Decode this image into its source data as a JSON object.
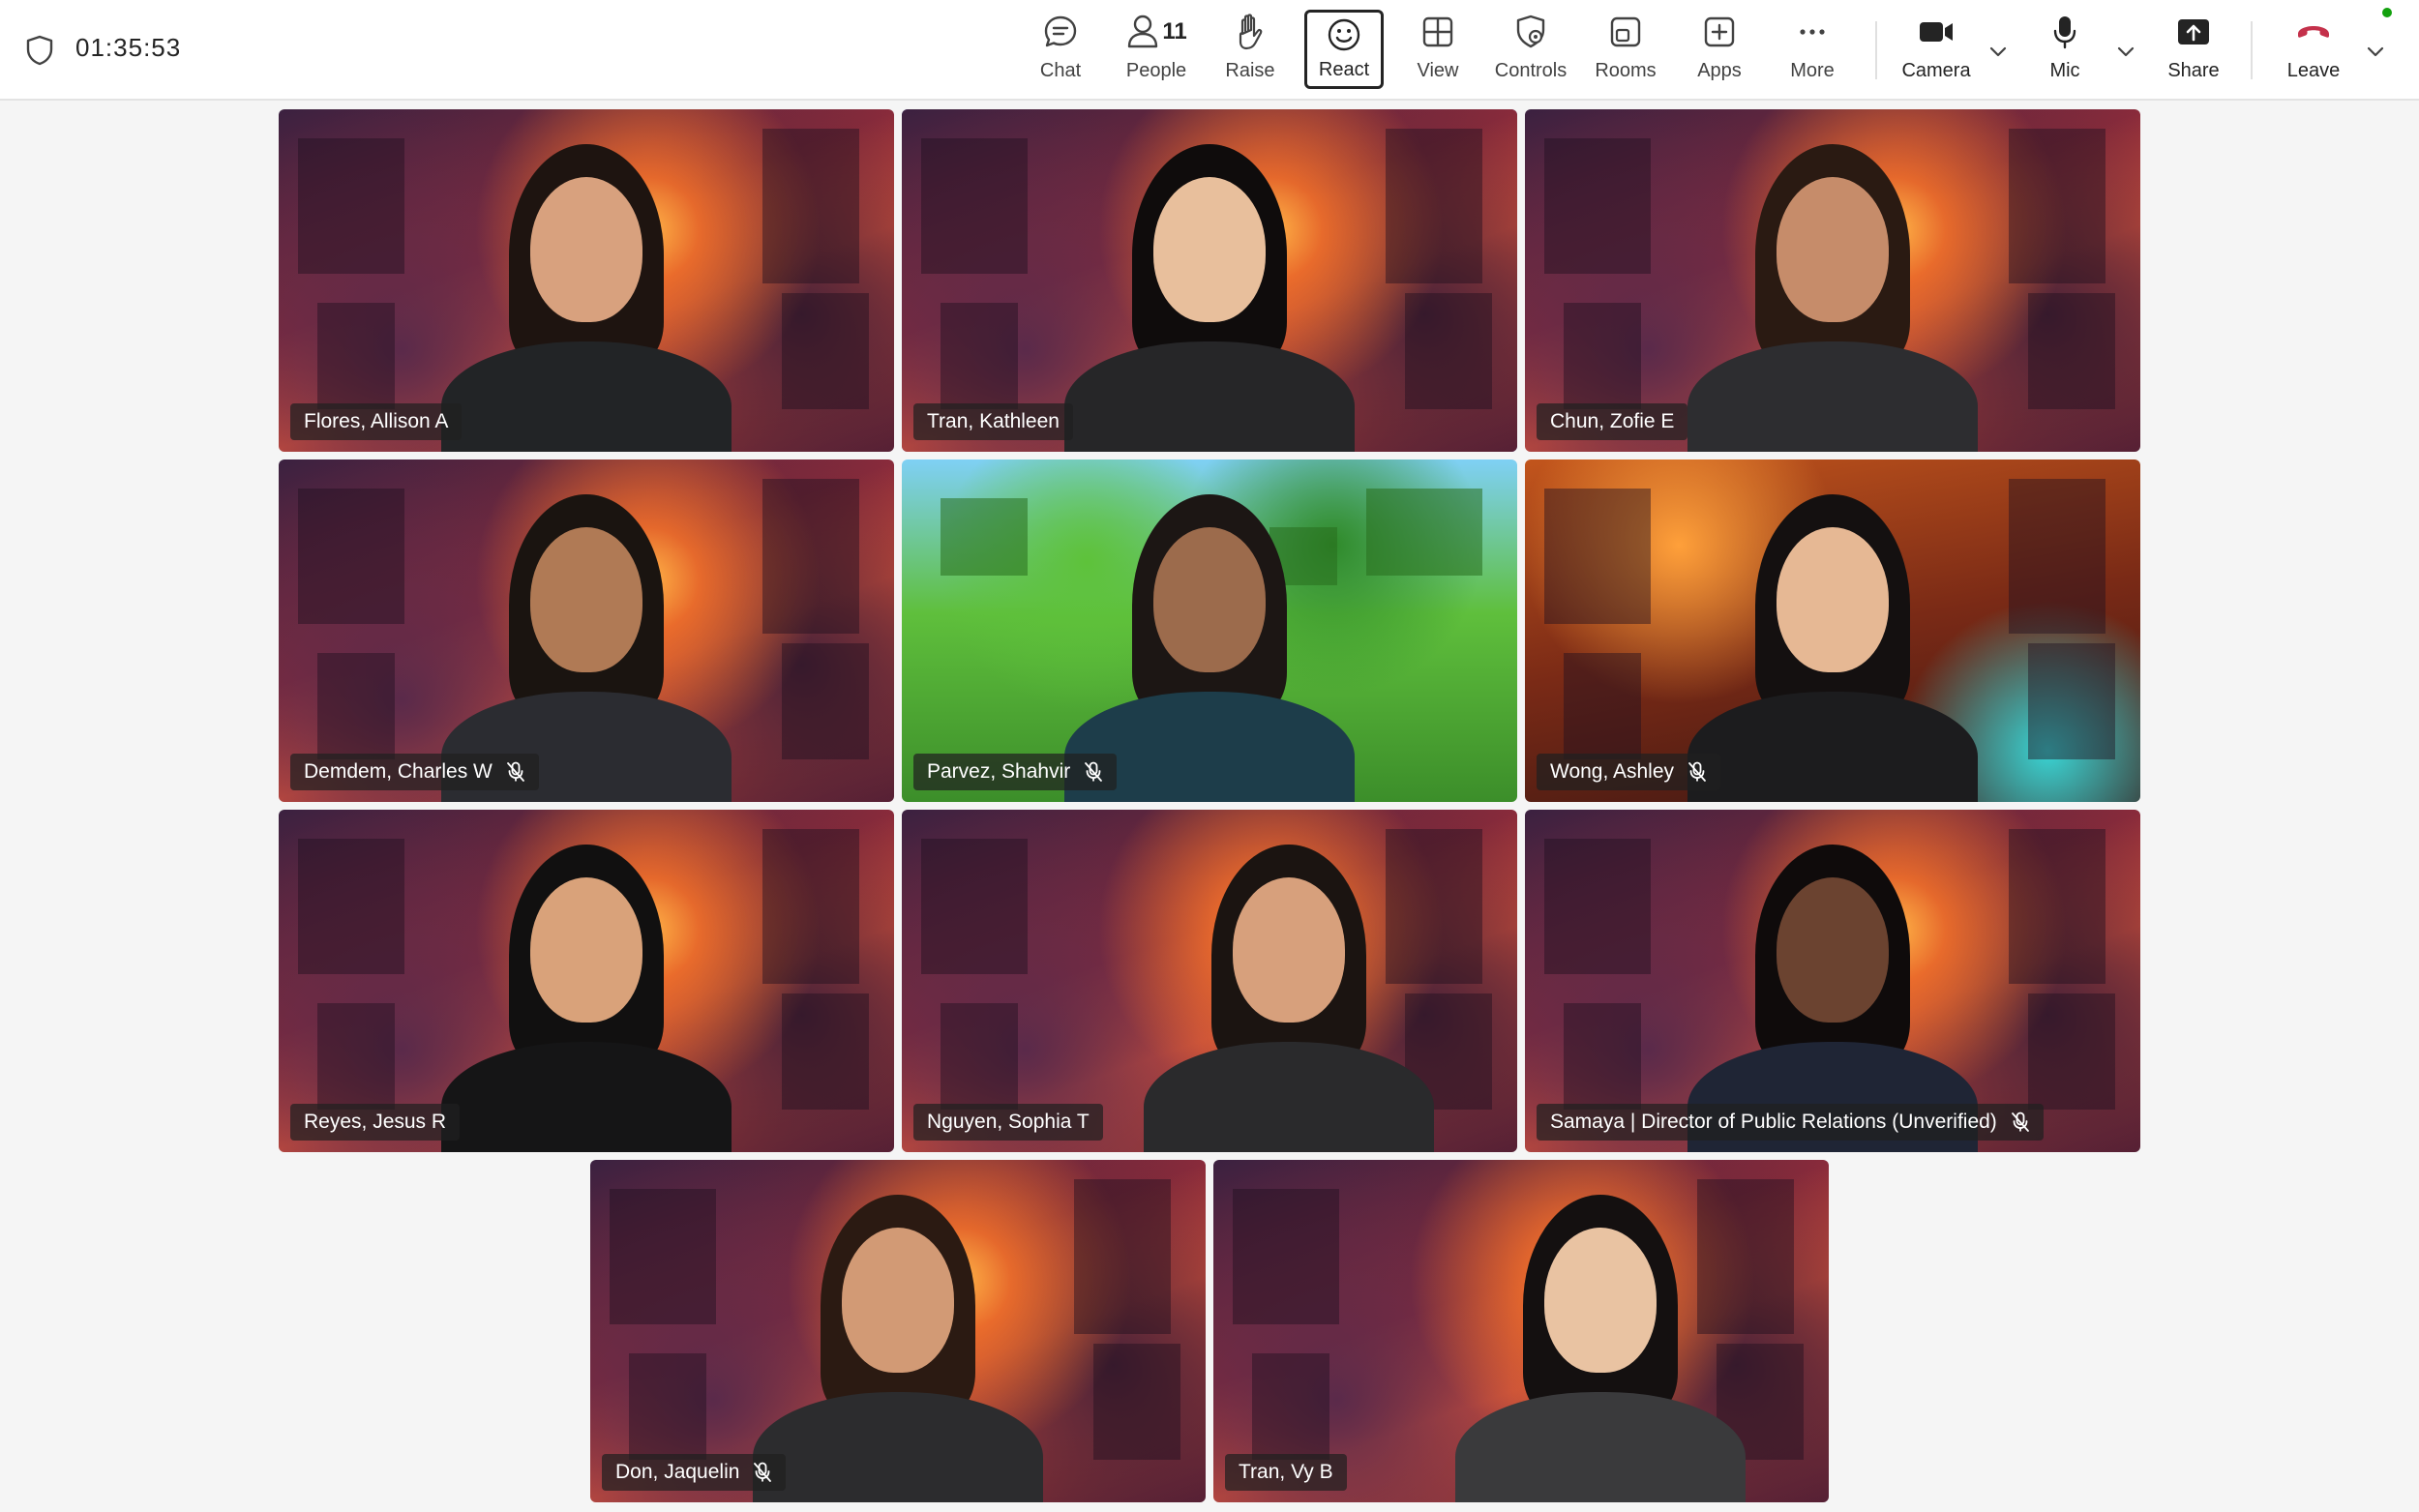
{
  "meeting": {
    "timer": "01:35:53"
  },
  "toolbar": {
    "chat": "Chat",
    "people": "People",
    "people_count": "11",
    "raise": "Raise",
    "react": "React",
    "view": "View",
    "controls": "Controls",
    "rooms": "Rooms",
    "apps": "Apps",
    "more": "More",
    "camera": "Camera",
    "mic": "Mic",
    "share": "Share",
    "leave": "Leave",
    "leave_color": "#c4314b"
  },
  "participants": [
    {
      "name": "Flores, Allison A",
      "muted": false,
      "background": "nether",
      "speaking": false
    },
    {
      "name": "Tran, Kathleen",
      "muted": false,
      "background": "nether",
      "speaking": true
    },
    {
      "name": "Chun, Zofie E",
      "muted": false,
      "background": "nether",
      "speaking": false
    },
    {
      "name": "Demdem, Charles W",
      "muted": true,
      "background": "nether",
      "speaking": false
    },
    {
      "name": "Parvez, Shahvir",
      "muted": true,
      "background": "forest",
      "speaking": false
    },
    {
      "name": "Wong, Ashley",
      "muted": true,
      "background": "lava",
      "speaking": false
    },
    {
      "name": "Reyes, Jesus R",
      "muted": false,
      "background": "nether",
      "speaking": false
    },
    {
      "name": "Nguyen, Sophia T",
      "muted": false,
      "background": "nether",
      "speaking": false
    },
    {
      "name": "Samaya | Director of Public Relations (Unverified)",
      "muted": true,
      "background": "nether",
      "speaking": false
    },
    {
      "name": "Don, Jaquelin",
      "muted": true,
      "background": "nether",
      "speaking": false
    },
    {
      "name": "Tran, Vy B",
      "muted": false,
      "background": "nether",
      "speaking": false
    }
  ],
  "colors": {
    "speaking_border": "#5b5fc7",
    "online": "#13a10e"
  }
}
